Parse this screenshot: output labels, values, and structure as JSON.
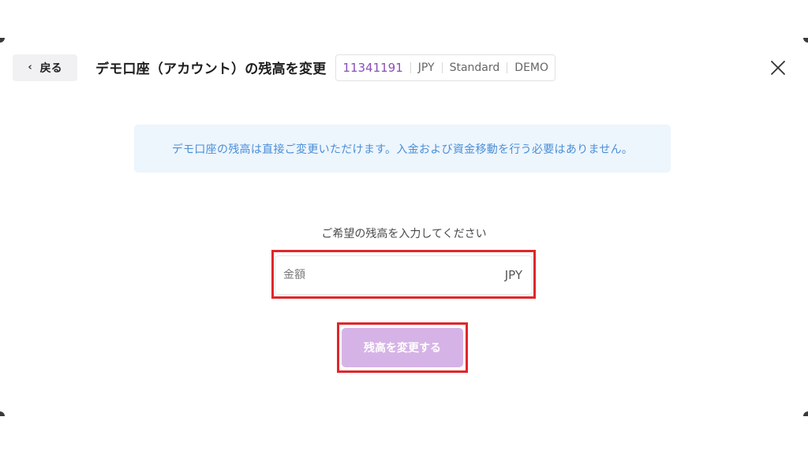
{
  "header": {
    "back_label": "戻る",
    "title": "デモ口座（アカウント）の残高を変更",
    "account": {
      "number": "11341191",
      "currency": "JPY",
      "type": "Standard",
      "mode": "DEMO"
    }
  },
  "notice": {
    "text": "デモ口座の残高は直接ご変更いただけます。入金および資金移動を行う必要はありません。"
  },
  "form": {
    "prompt": "ご希望の残高を入力してください",
    "amount_placeholder": "金額",
    "amount_value": "",
    "amount_unit": "JPY",
    "submit_label": "残高を変更する"
  },
  "icons": {
    "back": "chevron-left-icon",
    "close": "close-icon"
  },
  "colors": {
    "accent": "#8b4fb8",
    "button_disabled": "#d6b3e6",
    "notice_bg": "#edf5fd",
    "notice_text": "#4a8fd6",
    "highlight": "#e0262b"
  }
}
